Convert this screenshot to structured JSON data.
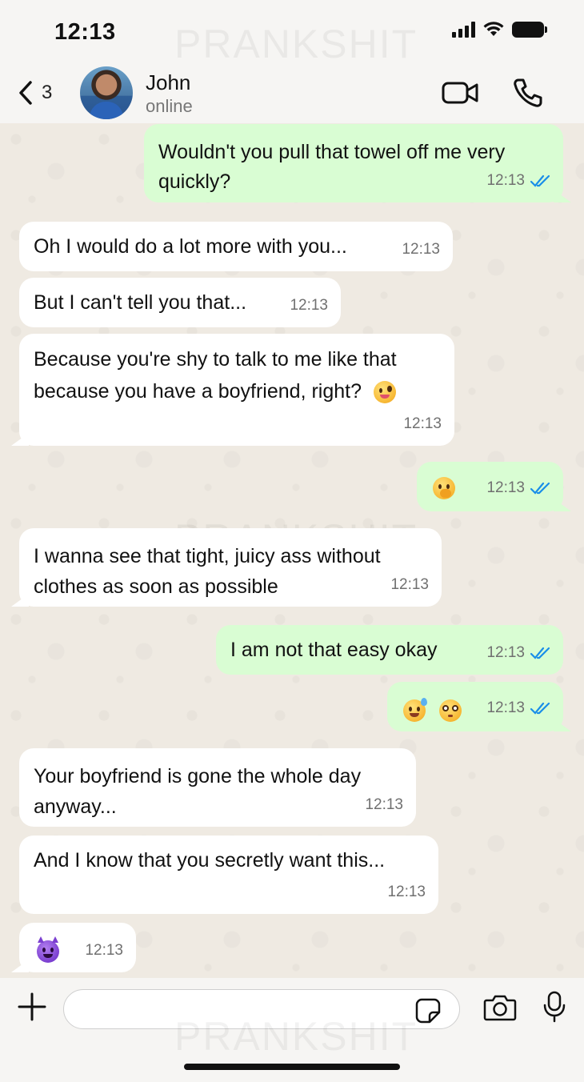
{
  "status_bar": {
    "time": "12:13"
  },
  "watermark": "PRANKSHIT",
  "header": {
    "back_count": "3",
    "contact_name": "John",
    "contact_status": "online"
  },
  "messages": [
    {
      "direction": "out",
      "text_line1": "Wouldn't you pull that towel off me very",
      "text_line2": "quickly?",
      "time": "12:13",
      "status": "read"
    },
    {
      "direction": "in",
      "text": "Oh I would do a lot more with you...",
      "time": "12:13"
    },
    {
      "direction": "in",
      "text": "But I can't tell you that...",
      "time": "12:13"
    },
    {
      "direction": "in",
      "text_line1": "Because you're shy to talk to me like that",
      "text_line2": "because you have a boyfriend, right?",
      "emoji": "zany-face",
      "time": "12:13"
    },
    {
      "direction": "out",
      "emoji": "face-with-hand-over-mouth",
      "time": "12:13",
      "status": "read"
    },
    {
      "direction": "in",
      "text_line1": "I wanna see that tight, juicy ass without",
      "text_line2": "clothes as soon as possible",
      "time": "12:13"
    },
    {
      "direction": "out",
      "text": "I am not that easy okay",
      "time": "12:13",
      "status": "read"
    },
    {
      "direction": "out",
      "emojis": [
        "grinning-face-with-sweat",
        "flushed-face"
      ],
      "time": "12:13",
      "status": "read"
    },
    {
      "direction": "in",
      "text_line1": "Your boyfriend is gone the whole day",
      "text_line2": "anyway...",
      "time": "12:13"
    },
    {
      "direction": "in",
      "text": "And I know that you secretly want this...",
      "time": "12:13"
    },
    {
      "direction": "in",
      "emoji": "smiling-face-with-horns",
      "time": "12:13"
    }
  ],
  "input": {
    "placeholder": ""
  },
  "colors": {
    "outgoing_bubble": "#d9fdd3",
    "incoming_bubble": "#ffffff",
    "read_ticks": "#1a8ee8",
    "chat_background": "#efeae2"
  }
}
